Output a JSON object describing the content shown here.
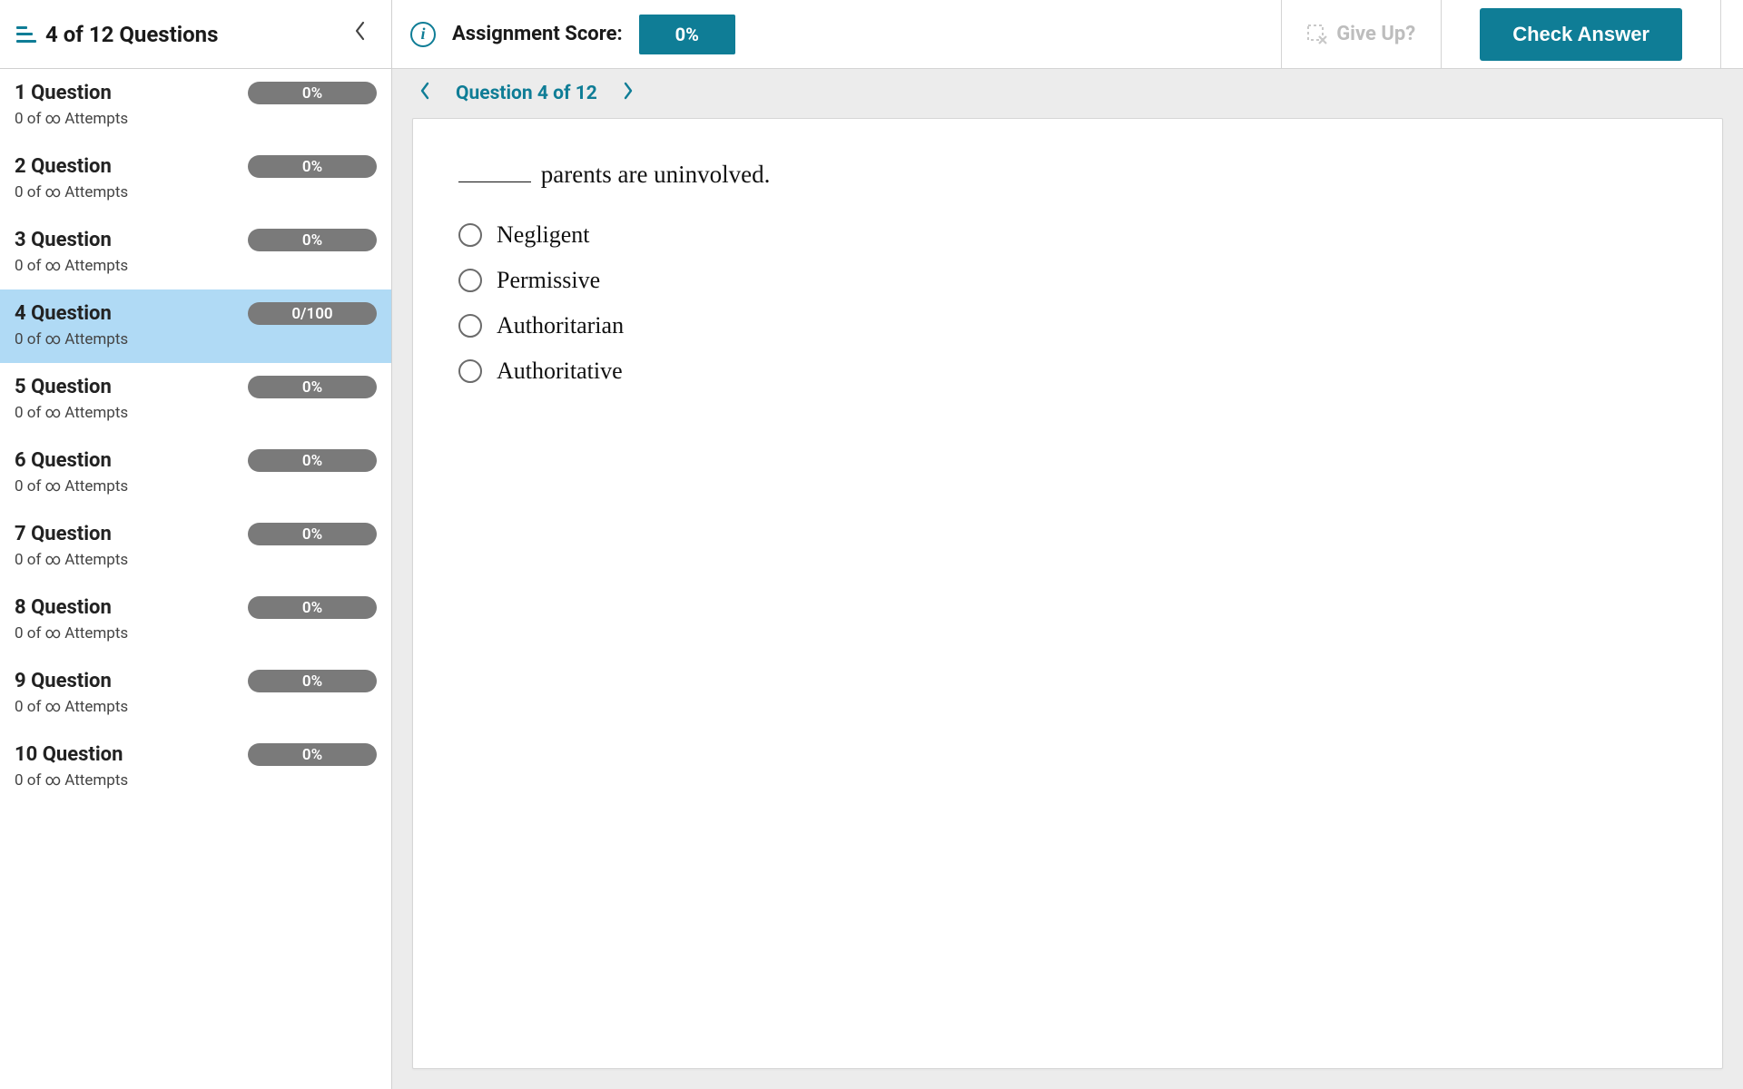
{
  "sidebar": {
    "title": "4 of 12 Questions",
    "items": [
      {
        "label": "1 Question",
        "pill": "0%",
        "attempts": "0 of ∞ Attempts",
        "active": false
      },
      {
        "label": "2 Question",
        "pill": "0%",
        "attempts": "0 of ∞ Attempts",
        "active": false
      },
      {
        "label": "3 Question",
        "pill": "0%",
        "attempts": "0 of ∞ Attempts",
        "active": false
      },
      {
        "label": "4 Question",
        "pill": "0/100",
        "attempts": "0 of ∞ Attempts",
        "active": true
      },
      {
        "label": "5 Question",
        "pill": "0%",
        "attempts": "0 of ∞ Attempts",
        "active": false
      },
      {
        "label": "6 Question",
        "pill": "0%",
        "attempts": "0 of ∞ Attempts",
        "active": false
      },
      {
        "label": "7 Question",
        "pill": "0%",
        "attempts": "0 of ∞ Attempts",
        "active": false
      },
      {
        "label": "8 Question",
        "pill": "0%",
        "attempts": "0 of ∞ Attempts",
        "active": false
      },
      {
        "label": "9 Question",
        "pill": "0%",
        "attempts": "0 of ∞ Attempts",
        "active": false
      },
      {
        "label": "10 Question",
        "pill": "0%",
        "attempts": "0 of ∞ Attempts",
        "active": false
      }
    ]
  },
  "topbar": {
    "score_label": "Assignment Score:",
    "score_value": "0%",
    "give_up_label": "Give Up?",
    "check_label": "Check Answer"
  },
  "breadcrumb": {
    "text": "Question 4 of 12"
  },
  "question": {
    "prompt_tail": " parents are uninvolved.",
    "options": [
      {
        "label": "Negligent"
      },
      {
        "label": "Permissive"
      },
      {
        "label": "Authoritarian"
      },
      {
        "label": "Authoritative"
      }
    ]
  }
}
